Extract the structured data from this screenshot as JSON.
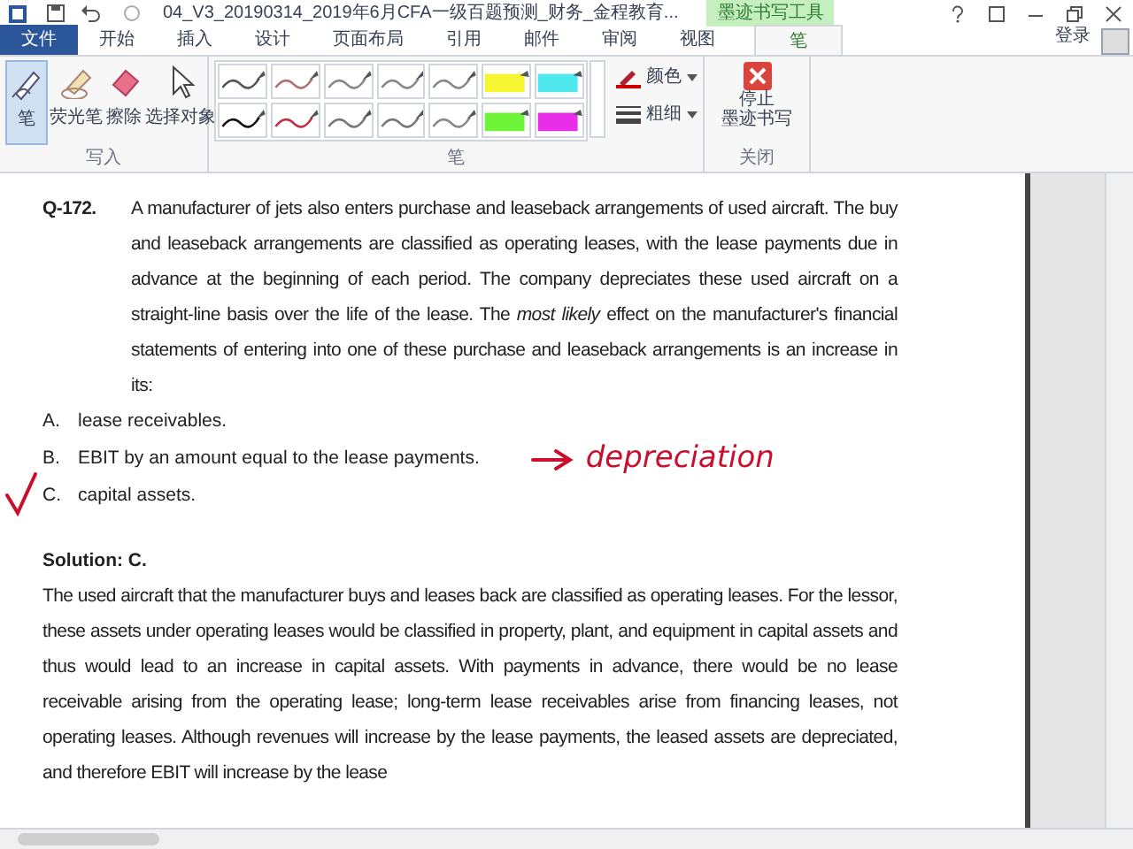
{
  "window": {
    "title": "04_V3_20190314_2019年6月CFA一级百题预测_财务_金程教育...",
    "context_tab_group": "墨迹书写工具",
    "sign_in": "登录"
  },
  "tabs": [
    {
      "label": "文件",
      "kind": "file",
      "selected": false
    },
    {
      "label": "开始",
      "kind": "tab",
      "selected": false
    },
    {
      "label": "插入",
      "kind": "tab",
      "selected": false
    },
    {
      "label": "设计",
      "kind": "tab",
      "selected": false
    },
    {
      "label": "页面布局",
      "kind": "tab",
      "selected": false
    },
    {
      "label": "引用",
      "kind": "tab",
      "selected": false
    },
    {
      "label": "邮件",
      "kind": "tab",
      "selected": false
    },
    {
      "label": "审阅",
      "kind": "tab",
      "selected": false
    },
    {
      "label": "视图",
      "kind": "tab",
      "selected": false
    },
    {
      "label": "笔",
      "kind": "context",
      "selected": true
    }
  ],
  "ribbon": {
    "write_group": {
      "label": "写入",
      "tools": [
        {
          "label": "笔",
          "kind": "pen",
          "selected": true
        },
        {
          "label": "荧光笔",
          "kind": "highlighter",
          "selected": false
        },
        {
          "label": "擦除",
          "kind": "eraser",
          "selected": false
        },
        {
          "label": "选择对象",
          "kind": "select",
          "selected": false
        }
      ]
    },
    "pens_group": {
      "label": "笔",
      "pens": [
        {
          "kind": "pen",
          "color": "#555555"
        },
        {
          "kind": "pen",
          "color": "#b07070"
        },
        {
          "kind": "pen",
          "color": "#888888"
        },
        {
          "kind": "pen",
          "color": "#888888"
        },
        {
          "kind": "pen",
          "color": "#888888"
        },
        {
          "kind": "marker",
          "color": "#f5f532"
        },
        {
          "kind": "marker",
          "color": "#4ee8ee"
        },
        {
          "kind": "pen",
          "color": "#111111"
        },
        {
          "kind": "pen",
          "color": "#c03040"
        },
        {
          "kind": "pen",
          "color": "#777777"
        },
        {
          "kind": "pen",
          "color": "#777777"
        },
        {
          "kind": "pen",
          "color": "#888888"
        },
        {
          "kind": "marker",
          "color": "#6ef53a"
        },
        {
          "kind": "marker",
          "color": "#e82ee8"
        }
      ],
      "color_button": "颜色",
      "weight_button": "粗细"
    },
    "close_group": {
      "label": "关闭",
      "button_lines": [
        "停止",
        "墨迹书写"
      ]
    }
  },
  "document": {
    "question_number": "Q-172.",
    "question": "A manufacturer of jets also enters purchase and leaseback arrangements of used aircraft. The buy and leaseback arrangements are classified as operating leases, with the lease payments due in advance at the beginning of each period. The company depreciates these used aircraft on a straight-line basis over the life of the lease. The *most likely* effect on the manufacturer's financial statements of entering into one of these purchase and leaseback arrangements is an increase in its:",
    "options": [
      {
        "letter": "A.",
        "text": "lease receivables."
      },
      {
        "letter": "B.",
        "text": "EBIT by an amount equal to the lease payments."
      },
      {
        "letter": "C.",
        "text": "capital assets."
      }
    ],
    "handwritten_note": "depreciation",
    "solution_heading": "Solution: C.",
    "solution": "The used aircraft that the manufacturer buys and leases back are classified as operating leases. For the lessor, these assets under operating leases would be classified in property, plant, and equipment in capital assets and thus would lead to an increase in capital assets. With payments in advance, there would be no lease receivable arising from the operating lease; long-term lease receivables arise from financing leases, not operating leases. Although revenues will increase by the lease payments, the leased assets are depreciated, and therefore EBIT will increase by the lease"
  }
}
